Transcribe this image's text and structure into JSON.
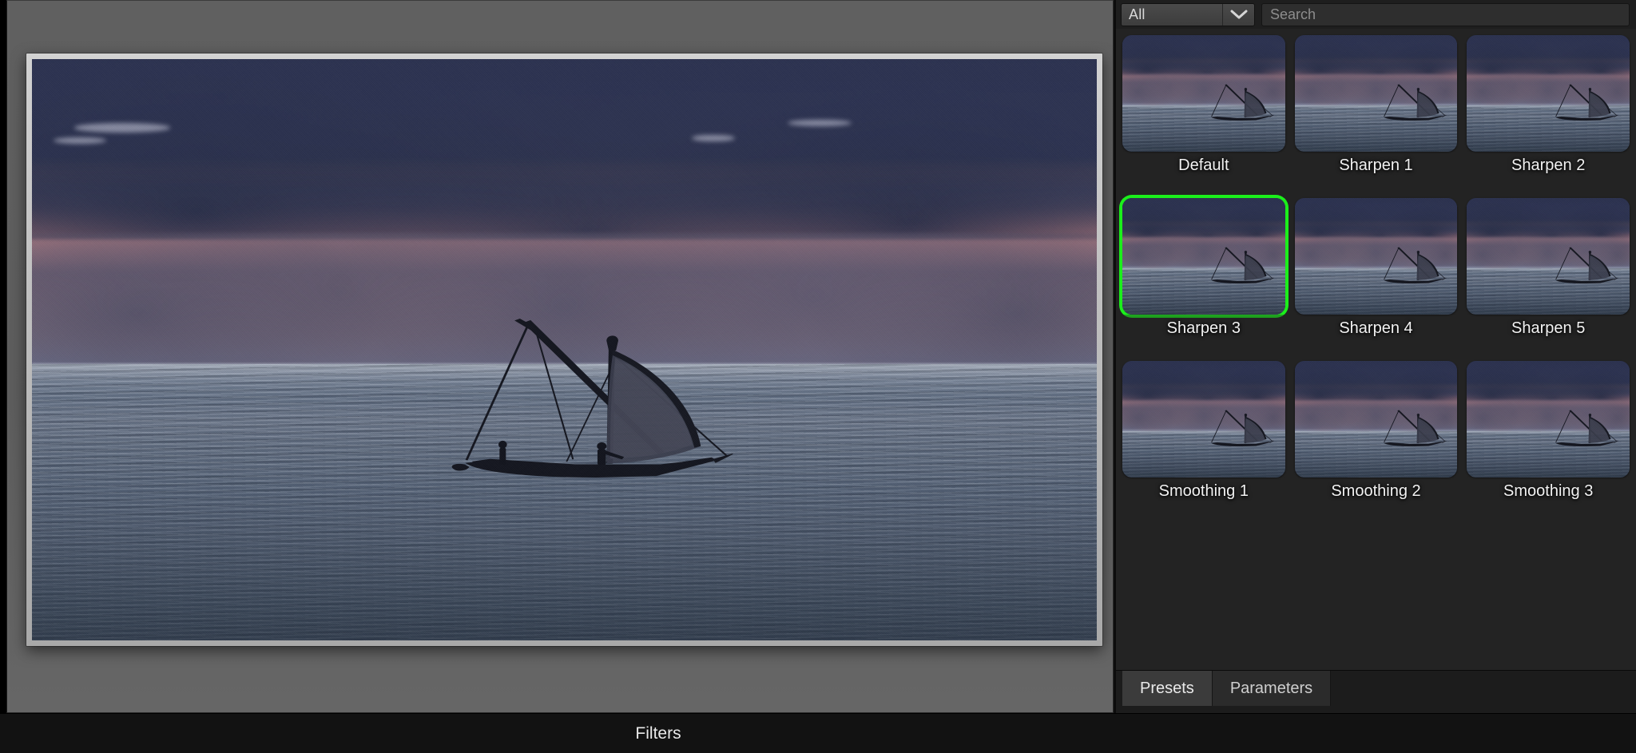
{
  "window": {
    "bottom_bar_title": "Filters"
  },
  "panel": {
    "filter_dropdown": {
      "selected": "All",
      "icon": "chevron-down-icon",
      "options": [
        "All"
      ]
    },
    "search": {
      "value": "",
      "placeholder": "Search"
    },
    "selection_color": "#1bef1b",
    "presets": [
      {
        "label": "Default",
        "selected": false
      },
      {
        "label": "Sharpen 1",
        "selected": false
      },
      {
        "label": "Sharpen 2",
        "selected": false
      },
      {
        "label": "Sharpen 3",
        "selected": true
      },
      {
        "label": "Sharpen 4",
        "selected": false
      },
      {
        "label": "Sharpen 5",
        "selected": false
      },
      {
        "label": "Smoothing 1",
        "selected": false
      },
      {
        "label": "Smoothing 2",
        "selected": false
      },
      {
        "label": "Smoothing 3",
        "selected": false
      }
    ],
    "tabs": [
      {
        "label": "Presets",
        "active": true
      },
      {
        "label": "Parameters",
        "active": false
      }
    ]
  },
  "canvas": {
    "background_color": "#5e5e5e",
    "image_description": "Sunset over the ocean with a silhouetted dhow sailboat"
  }
}
